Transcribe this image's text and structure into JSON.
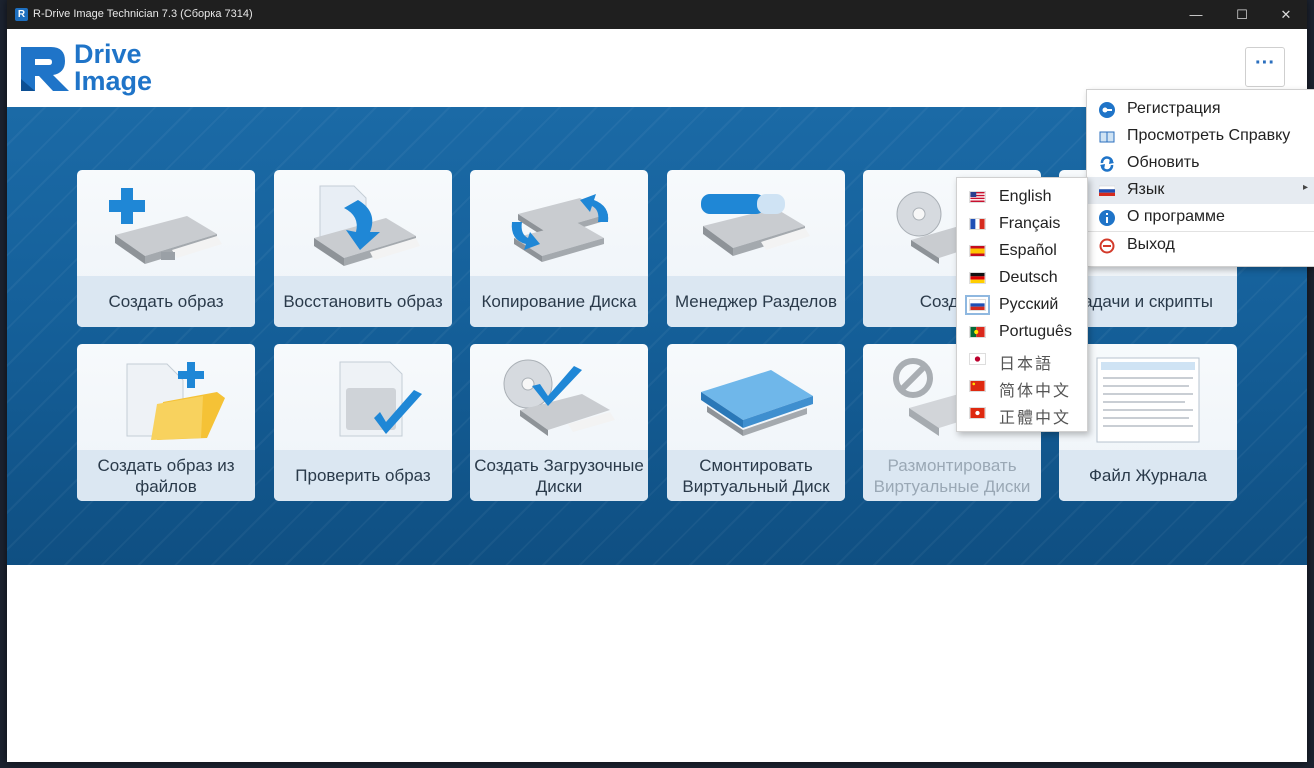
{
  "window": {
    "title": "R-Drive Image Technician 7.3 (Сборка 7314)",
    "app_icon": "R",
    "controls": {
      "minimize": "—",
      "maximize": "☐",
      "close": "✕"
    }
  },
  "logo": {
    "line1": "Drive",
    "line2": "Image"
  },
  "more_button": {
    "label": "···"
  },
  "tiles": [
    {
      "label": "Создать образ",
      "icon": "create-image-icon"
    },
    {
      "label": "Восстановить образ",
      "icon": "restore-image-icon"
    },
    {
      "label": "Копирование Диска",
      "icon": "disk-copy-icon"
    },
    {
      "label": "Менеджер Разделов",
      "icon": "partition-manager-icon"
    },
    {
      "label": "Создать",
      "icon": "create-startup-icon"
    },
    {
      "label": "адачи и скрипты",
      "icon": "tasks-scripts-icon"
    },
    {
      "label": "Создать образ из файлов",
      "icon": "file-image-icon"
    },
    {
      "label": "Проверить образ",
      "icon": "check-image-icon"
    },
    {
      "label": "Создать Загрузочные Диски",
      "icon": "boot-disk-icon"
    },
    {
      "label": "Смонтировать Виртуальный Диск",
      "icon": "mount-virtual-disk-icon"
    },
    {
      "label": "Размонтировать Виртуальные Диски",
      "icon": "unmount-virtual-disk-icon",
      "disabled": true
    },
    {
      "label": "Файл Журнала",
      "icon": "log-file-icon"
    }
  ],
  "main_menu": {
    "items": [
      {
        "label": "Регистрация",
        "icon": "key-icon"
      },
      {
        "label": "Просмотреть Справку",
        "icon": "book-icon"
      },
      {
        "label": "Обновить",
        "icon": "refresh-icon"
      },
      {
        "label": "Язык",
        "icon": "flag-icon",
        "has_submenu": true,
        "submenu_arrow": "▸"
      },
      {
        "label": "О программе",
        "icon": "info-icon"
      },
      {
        "label": "Выход",
        "icon": "exit-icon"
      }
    ]
  },
  "language_menu": {
    "items": [
      {
        "label": "English",
        "flag": "us"
      },
      {
        "label": "Français",
        "flag": "fr"
      },
      {
        "label": "Español",
        "flag": "es"
      },
      {
        "label": "Deutsch",
        "flag": "de"
      },
      {
        "label": "Русский",
        "flag": "ru",
        "selected": true
      },
      {
        "label": "Português",
        "flag": "pt"
      },
      {
        "label": "日本語",
        "flag": "jp"
      },
      {
        "label": "简体中文",
        "flag": "cn"
      },
      {
        "label": "正體中文",
        "flag": "hk"
      }
    ]
  },
  "colors": {
    "accent": "#1f74c8",
    "banner": "#15609a",
    "tile_label_bg": "#dbe7f2"
  }
}
